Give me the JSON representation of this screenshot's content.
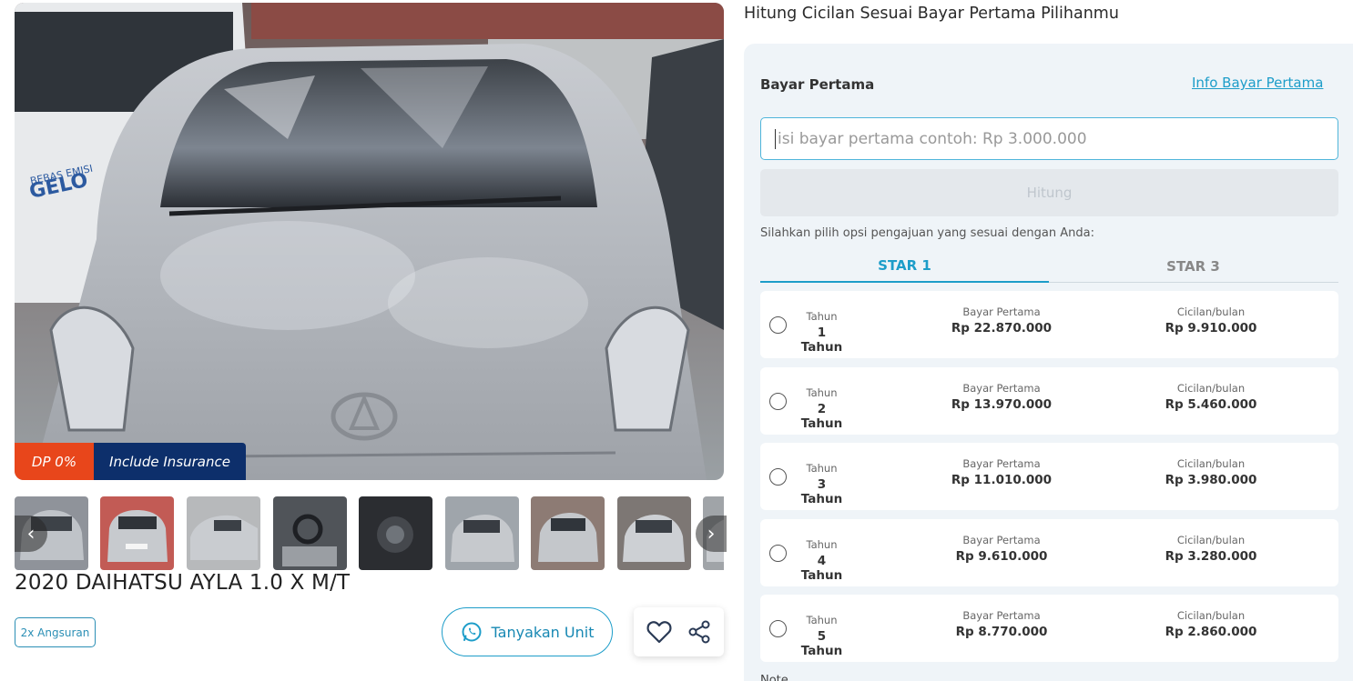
{
  "gallery": {
    "badges": {
      "dp": "DP 0%",
      "insurance": "Include Insurance"
    },
    "thumbnail_count": 9,
    "prev_icon": "chevron-left-icon",
    "next_icon": "chevron-right-icon"
  },
  "listing": {
    "title": "2020 DAIHATSU AYLA 1.0 X M/T",
    "tag": "2x Angsuran",
    "ask_button": "Tanyakan Unit",
    "ask_icon": "whatsapp-icon",
    "favorite_icon": "heart-icon",
    "share_icon": "share-icon"
  },
  "calculator": {
    "heading": "Hitung Cicilan Sesuai Bayar Pertama Pilihanmu",
    "label": "Bayar Pertama",
    "info_link": "Info Bayar Pertama",
    "input_value": "",
    "input_placeholder": "isi bayar pertama contoh: Rp 3.000.000",
    "submit_label": "Hitung",
    "options_prompt": "Silahkan pilih opsi pengajuan yang sesuai dengan Anda:",
    "tabs": [
      {
        "label": "STAR 1",
        "active": true
      },
      {
        "label": "STAR 3",
        "active": false
      }
    ],
    "column_labels": {
      "tenor": "Tahun",
      "down_payment": "Bayar Pertama",
      "installment": "Cicilan/bulan"
    },
    "options": [
      {
        "tenor": "1 Tahun",
        "down_payment": "Rp 22.870.000",
        "installment": "Rp 9.910.000"
      },
      {
        "tenor": "2 Tahun",
        "down_payment": "Rp 13.970.000",
        "installment": "Rp 5.460.000"
      },
      {
        "tenor": "3 Tahun",
        "down_payment": "Rp 11.010.000",
        "installment": "Rp 3.980.000"
      },
      {
        "tenor": "4 Tahun",
        "down_payment": "Rp 9.610.000",
        "installment": "Rp 3.280.000"
      },
      {
        "tenor": "5 Tahun",
        "down_payment": "Rp 8.770.000",
        "installment": "Rp 2.860.000"
      }
    ],
    "note_label": "Note"
  },
  "colors": {
    "accent": "#1d9dc9",
    "dp_badge": "#e8461b",
    "insurance_badge": "#0d2f6b",
    "panel_bg": "#eff4f8"
  }
}
